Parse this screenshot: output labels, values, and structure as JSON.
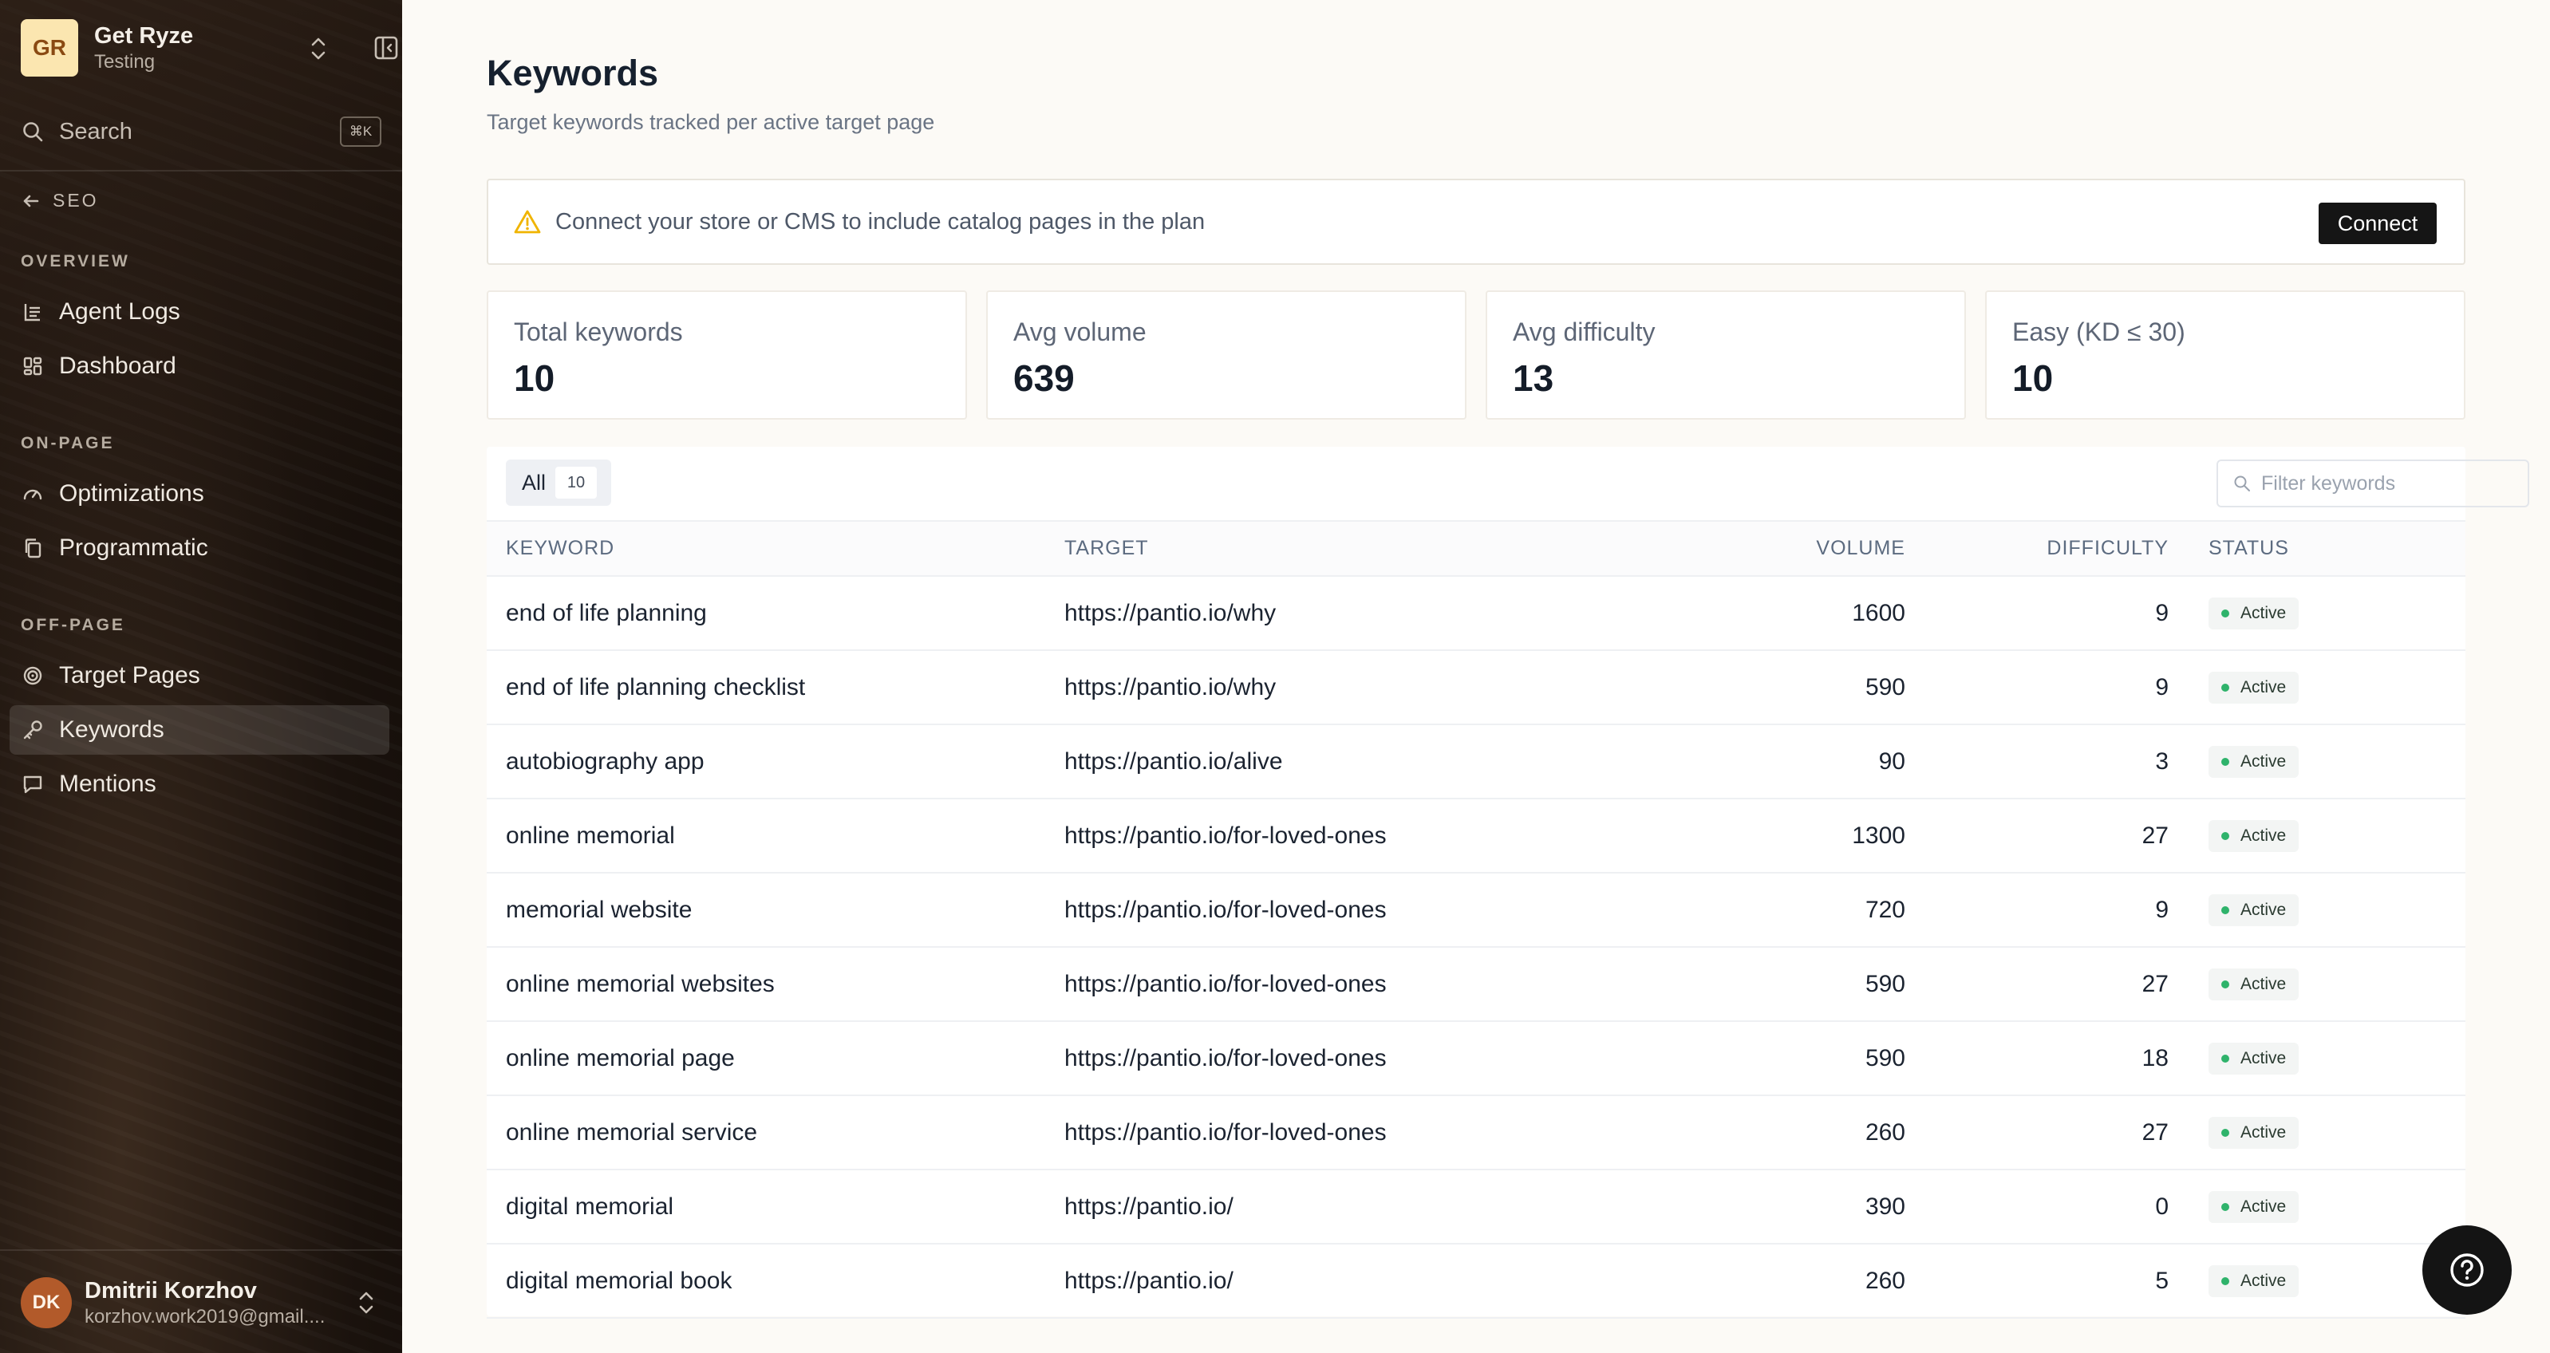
{
  "workspace": {
    "initials": "GR",
    "name": "Get Ryze",
    "env": "Testing"
  },
  "search": {
    "label": "Search",
    "shortcut": "⌘K"
  },
  "nav": {
    "back_label": "SEO",
    "sections": [
      {
        "title": "OVERVIEW",
        "items": [
          {
            "label": "Agent Logs",
            "icon": "log-icon"
          },
          {
            "label": "Dashboard",
            "icon": "dashboard-icon"
          }
        ]
      },
      {
        "title": "ON-PAGE",
        "items": [
          {
            "label": "Optimizations",
            "icon": "gauge-icon"
          },
          {
            "label": "Programmatic",
            "icon": "copy-icon"
          }
        ]
      },
      {
        "title": "OFF-PAGE",
        "items": [
          {
            "label": "Target Pages",
            "icon": "target-icon"
          },
          {
            "label": "Keywords",
            "icon": "key-icon"
          },
          {
            "label": "Mentions",
            "icon": "message-icon"
          }
        ]
      }
    ],
    "active": "Keywords"
  },
  "user": {
    "initials": "DK",
    "name": "Dmitrii Korzhov",
    "email": "korzhov.work2019@gmail...."
  },
  "page": {
    "title": "Keywords",
    "subtitle": "Target keywords tracked per active target page"
  },
  "alert": {
    "text": "Connect your store or CMS to include catalog pages in the plan",
    "button": "Connect"
  },
  "stats": [
    {
      "label": "Total keywords",
      "value": "10"
    },
    {
      "label": "Avg volume",
      "value": "639"
    },
    {
      "label": "Avg difficulty",
      "value": "13"
    },
    {
      "label": "Easy (KD ≤ 30)",
      "value": "10"
    }
  ],
  "table": {
    "tab": {
      "label": "All",
      "count": "10"
    },
    "filter_placeholder": "Filter keywords",
    "columns": [
      "KEYWORD",
      "TARGET",
      "VOLUME",
      "DIFFICULTY",
      "STATUS"
    ],
    "rows": [
      {
        "keyword": "end of life planning",
        "target": "https://pantio.io/why",
        "volume": "1600",
        "difficulty": "9",
        "status": "Active"
      },
      {
        "keyword": "end of life planning checklist",
        "target": "https://pantio.io/why",
        "volume": "590",
        "difficulty": "9",
        "status": "Active"
      },
      {
        "keyword": "autobiography app",
        "target": "https://pantio.io/alive",
        "volume": "90",
        "difficulty": "3",
        "status": "Active"
      },
      {
        "keyword": "online memorial",
        "target": "https://pantio.io/for-loved-ones",
        "volume": "1300",
        "difficulty": "27",
        "status": "Active"
      },
      {
        "keyword": "memorial website",
        "target": "https://pantio.io/for-loved-ones",
        "volume": "720",
        "difficulty": "9",
        "status": "Active"
      },
      {
        "keyword": "online memorial websites",
        "target": "https://pantio.io/for-loved-ones",
        "volume": "590",
        "difficulty": "27",
        "status": "Active"
      },
      {
        "keyword": "online memorial page",
        "target": "https://pantio.io/for-loved-ones",
        "volume": "590",
        "difficulty": "18",
        "status": "Active"
      },
      {
        "keyword": "online memorial service",
        "target": "https://pantio.io/for-loved-ones",
        "volume": "260",
        "difficulty": "27",
        "status": "Active"
      },
      {
        "keyword": "digital memorial",
        "target": "https://pantio.io/",
        "volume": "390",
        "difficulty": "0",
        "status": "Active"
      },
      {
        "keyword": "digital memorial book",
        "target": "https://pantio.io/",
        "volume": "260",
        "difficulty": "5",
        "status": "Active"
      }
    ]
  },
  "colors": {
    "accent_warning": "#f0b400",
    "status_active": "#2fb36b",
    "sidebar_bg": "#1a120d"
  },
  "help": {
    "icon": "help-icon"
  }
}
